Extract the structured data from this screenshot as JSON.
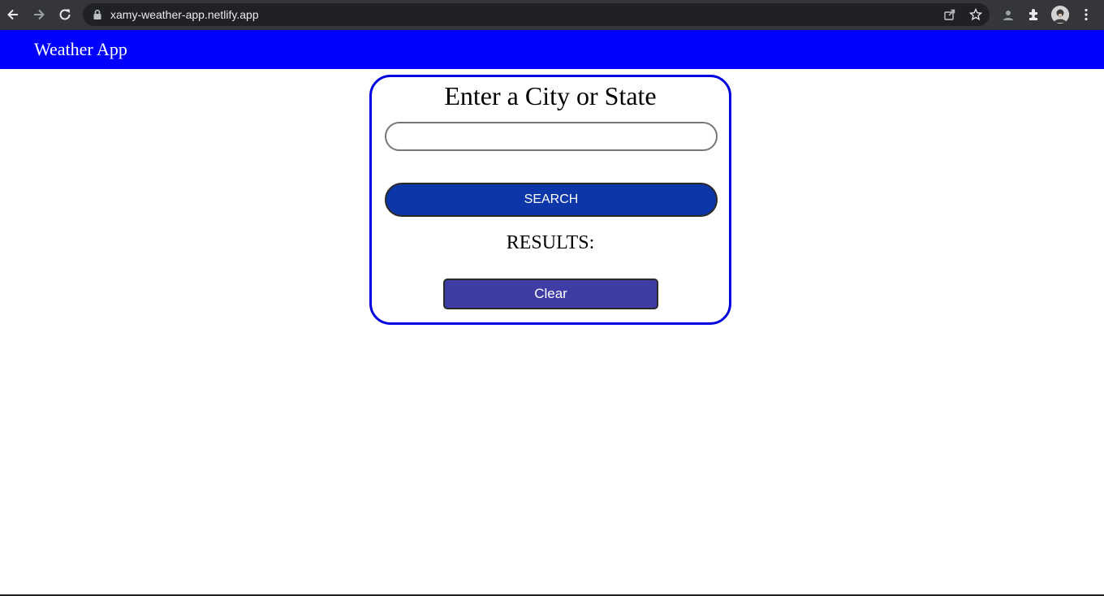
{
  "browser": {
    "url": "xamy-weather-app.netlify.app",
    "icons": {
      "back": "arrow-left-icon",
      "forward": "arrow-right-icon",
      "reload": "reload-icon",
      "lock": "lock-icon",
      "share": "share-icon",
      "bookmark": "star-icon",
      "profile_badge": "incognito-icon",
      "extensions": "puzzle-icon",
      "menu": "kebab-menu-icon"
    },
    "colors": {
      "frame": "#35363a",
      "omnibox": "#202124"
    }
  },
  "app": {
    "brand": "Weather App",
    "colors": {
      "navbar": "#0000ff",
      "card_border": "#0000e0",
      "search_button": "#0d37a8",
      "clear_button": "#3e3ca5"
    }
  },
  "search_card": {
    "heading": "Enter a City or State",
    "input_value": "",
    "search_label": "SEARCH",
    "results_label": "RESULTS:",
    "clear_label": "Clear"
  }
}
